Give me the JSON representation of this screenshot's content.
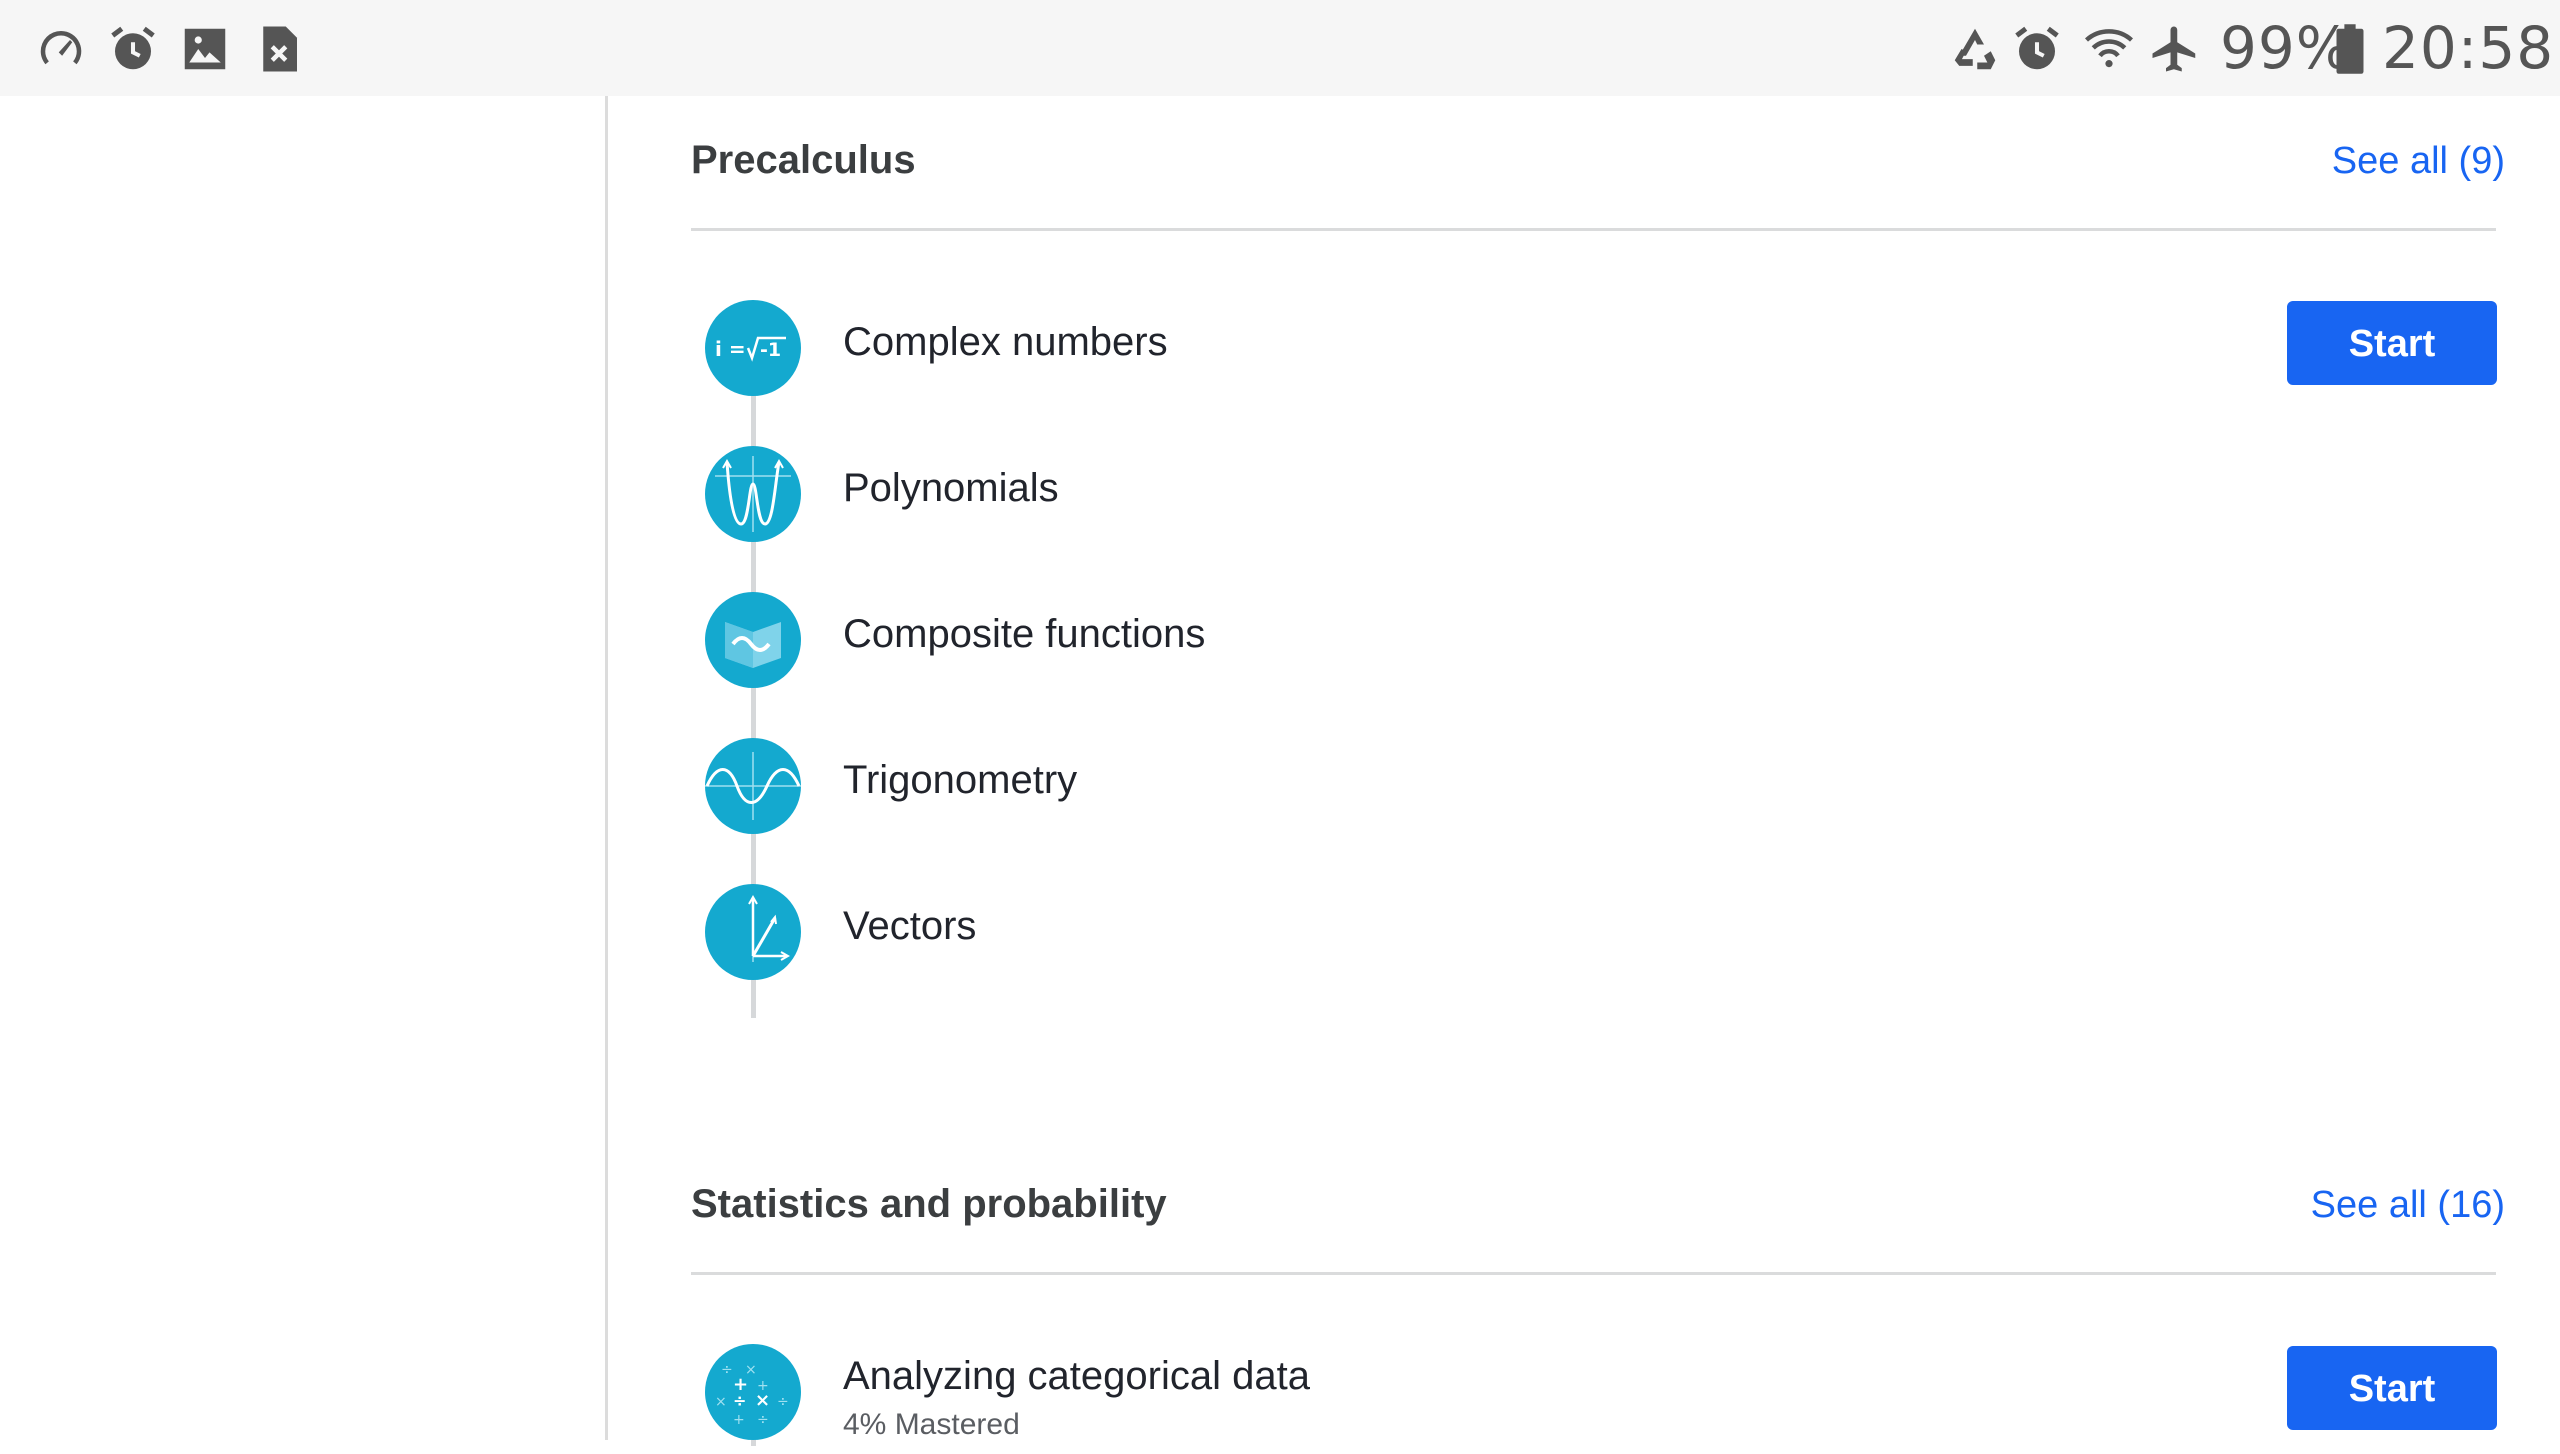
{
  "status_bar": {
    "left_icons": [
      "speedometer-icon",
      "alarm-icon",
      "image-icon",
      "close-file-icon"
    ],
    "right_icons": [
      "data-recycle-icon",
      "alarm-icon",
      "wifi-icon",
      "airplane-icon",
      "battery-icon"
    ],
    "battery_percent": "99%",
    "time": "20:58"
  },
  "sections": [
    {
      "title": "Precalculus",
      "see_all": "See all (9)",
      "topics": [
        {
          "label": "Complex numbers",
          "icon": "complex-numbers-icon",
          "button": "Start"
        },
        {
          "label": "Polynomials",
          "icon": "polynomials-icon"
        },
        {
          "label": "Composite functions",
          "icon": "composite-functions-icon"
        },
        {
          "label": "Trigonometry",
          "icon": "trigonometry-icon"
        },
        {
          "label": "Vectors",
          "icon": "vectors-icon"
        }
      ]
    },
    {
      "title": "Statistics and probability",
      "see_all": "See all (16)",
      "topics": [
        {
          "label": "Analyzing categorical data",
          "icon": "categorical-data-icon",
          "subtitle": "4% Mastered",
          "button": "Start"
        }
      ]
    }
  ],
  "colors": {
    "accent": "#1865f2",
    "icon_teal": "#14a9cf",
    "status_bar_bg": "#f6f6f6"
  }
}
